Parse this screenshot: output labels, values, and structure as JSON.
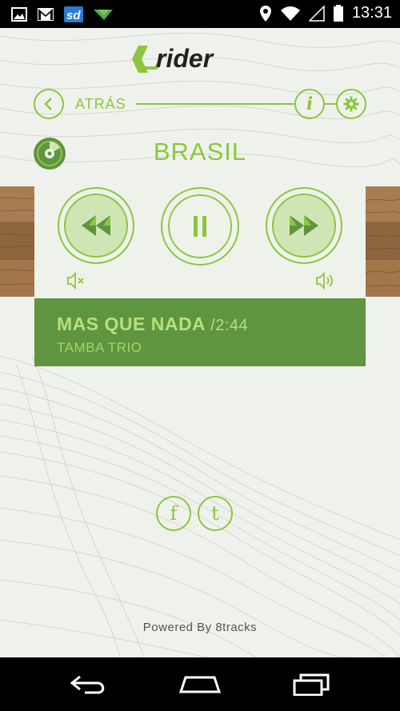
{
  "status_bar": {
    "time": "13:31",
    "notification_icons": [
      "gallery-icon",
      "gmail-icon",
      "sd-icon",
      "download-icon"
    ],
    "system_icons": [
      "location-icon",
      "wifi-icon",
      "signal-icon",
      "battery-icon"
    ]
  },
  "brand": {
    "logo_text": "rider",
    "accent_color": "#8cc63f",
    "dark_green": "#5f9441"
  },
  "nav": {
    "back_label": "ATRÁS",
    "info_label": "i"
  },
  "station": {
    "title": "BRASIL"
  },
  "player": {
    "volume_level": 0.98,
    "state": "playing"
  },
  "now_playing": {
    "title": "MAS QUE NADA",
    "duration": "/2:44",
    "artist": "TAMBA TRIO"
  },
  "social": {
    "facebook_label": "f",
    "twitter_label": "t"
  },
  "footer": {
    "powered_by": "Powered By 8tracks"
  }
}
